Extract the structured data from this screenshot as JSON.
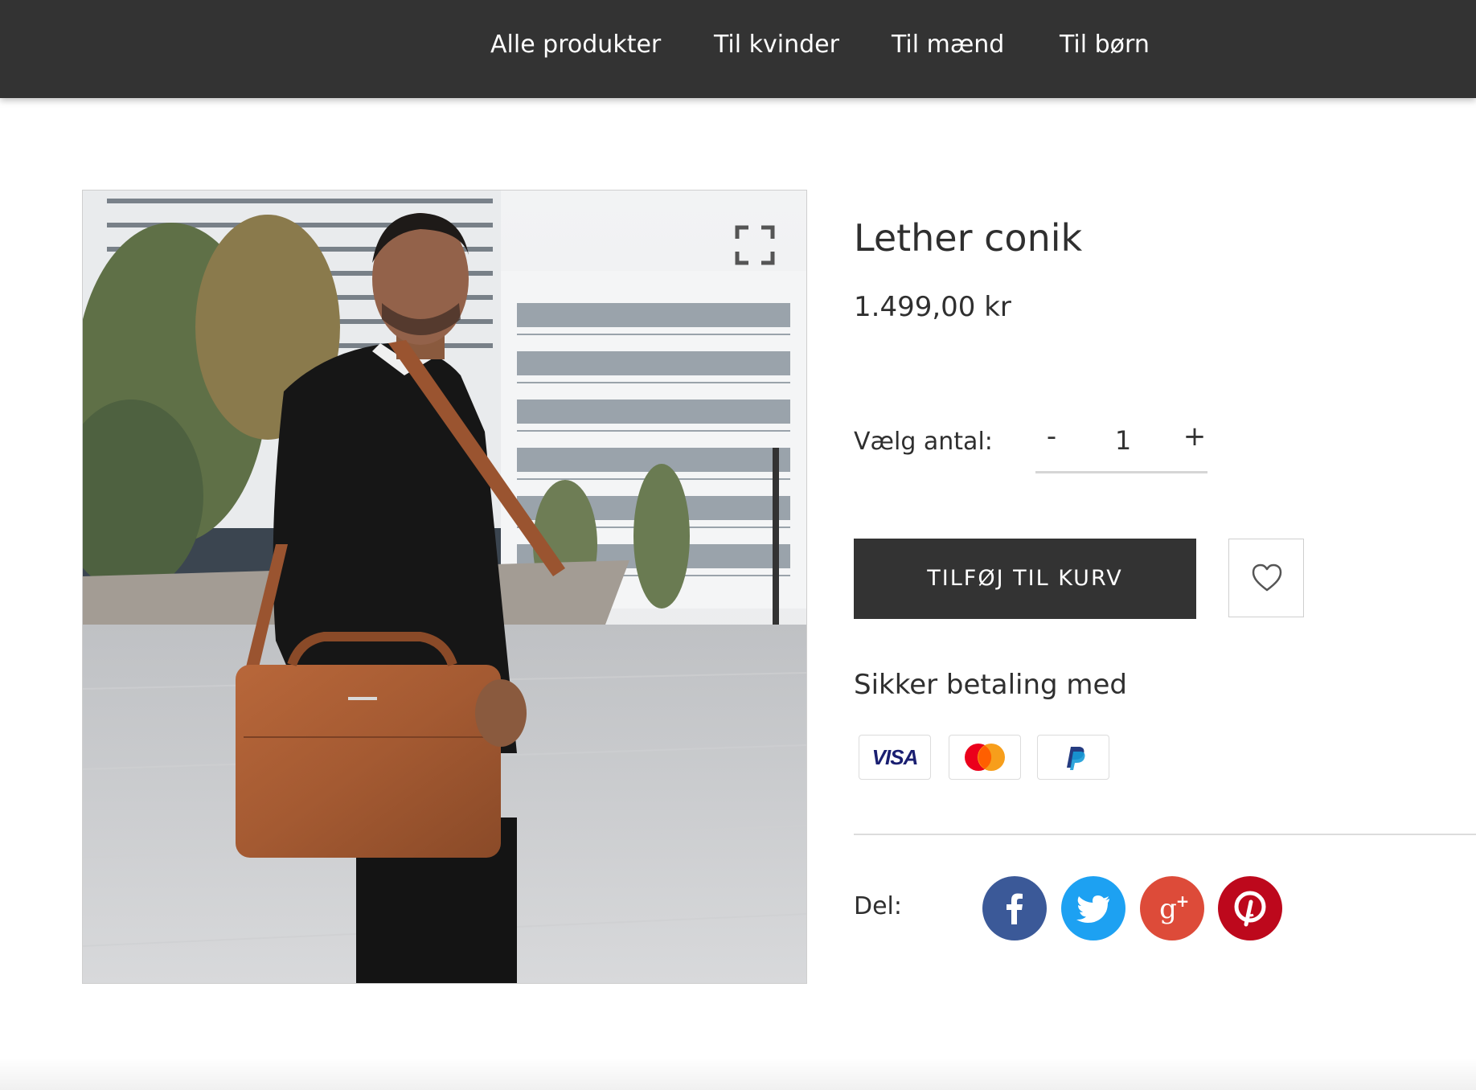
{
  "nav": {
    "items": [
      {
        "label": "Alle produkter"
      },
      {
        "label": "Til kvinder"
      },
      {
        "label": "Til mænd"
      },
      {
        "label": "Til børn"
      }
    ]
  },
  "product": {
    "title": "Lether conik",
    "price": "1.499,00 kr",
    "quantity_label": "Vælg antal:",
    "quantity_value": "1",
    "minus_label": "-",
    "plus_label": "+",
    "add_to_cart_label": "TILFØJ TIL KURV",
    "secure_payment_label": "Sikker betaling med",
    "payment_methods": [
      {
        "name": "visa",
        "label": "VISA"
      },
      {
        "name": "mastercard"
      },
      {
        "name": "paypal"
      }
    ],
    "share_label": "Del:",
    "share_networks": [
      "facebook",
      "twitter",
      "google-plus",
      "pinterest"
    ]
  },
  "colors": {
    "nav_bg": "#333333",
    "button_bg": "#333333",
    "facebook": "#3b5998",
    "twitter": "#1da1f2",
    "google_plus": "#dd4b39",
    "pinterest": "#bd081c"
  }
}
